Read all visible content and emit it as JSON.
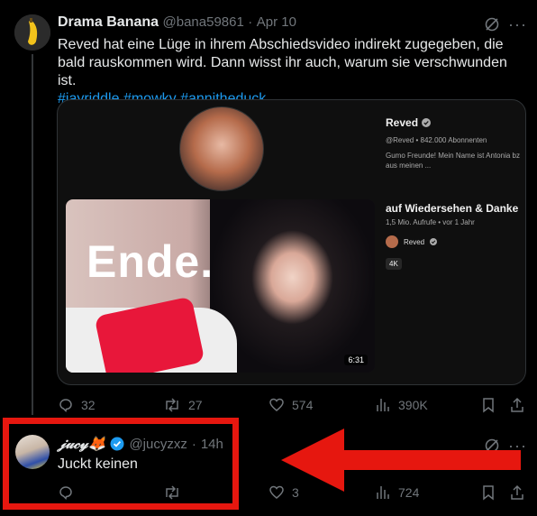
{
  "tweet": {
    "author_name": "Drama Banana",
    "author_handle": "@bana59861",
    "separator": "·",
    "date": "Apr 10",
    "text": "Reved hat eine Lüge in ihrem Abschiedsvideo indirekt zugegeben, die bald rauskommen wird. Dann wisst ihr auch, warum sie verschwunden ist.",
    "hashtags": [
      "#jayriddle",
      "#mowky",
      "#annitheduck"
    ],
    "card": {
      "channel_name": "Reved",
      "channel_meta": "@Reved • 842.000 Abonnenten",
      "channel_desc_line1": "Gumo Freunde! Mein Name ist Antonia bz",
      "channel_desc_line2": "aus meinen ...",
      "thumbnail_text": "Ende.",
      "duration": "6:31",
      "video_title": "auf Wiedersehen & Danke",
      "video_meta": "1,5 Mio. Aufrufe • vor 1 Jahr",
      "video_channel": "Reved",
      "quality_badge": "4K"
    },
    "actions": {
      "replies": "32",
      "retweets": "27",
      "likes": "574",
      "views": "390K"
    }
  },
  "reply": {
    "author_name": "𝒿𝓊𝒸𝓎🦊",
    "author_handle": "@jucyzxz",
    "separator": "·",
    "date": "14h",
    "text": "Juckt keinen",
    "actions": {
      "replies": "",
      "retweets": "",
      "likes": "3",
      "views": "724"
    }
  },
  "colors": {
    "accent": "#1d9bf0",
    "annotation": "#e6170f",
    "muted": "#71767b"
  }
}
